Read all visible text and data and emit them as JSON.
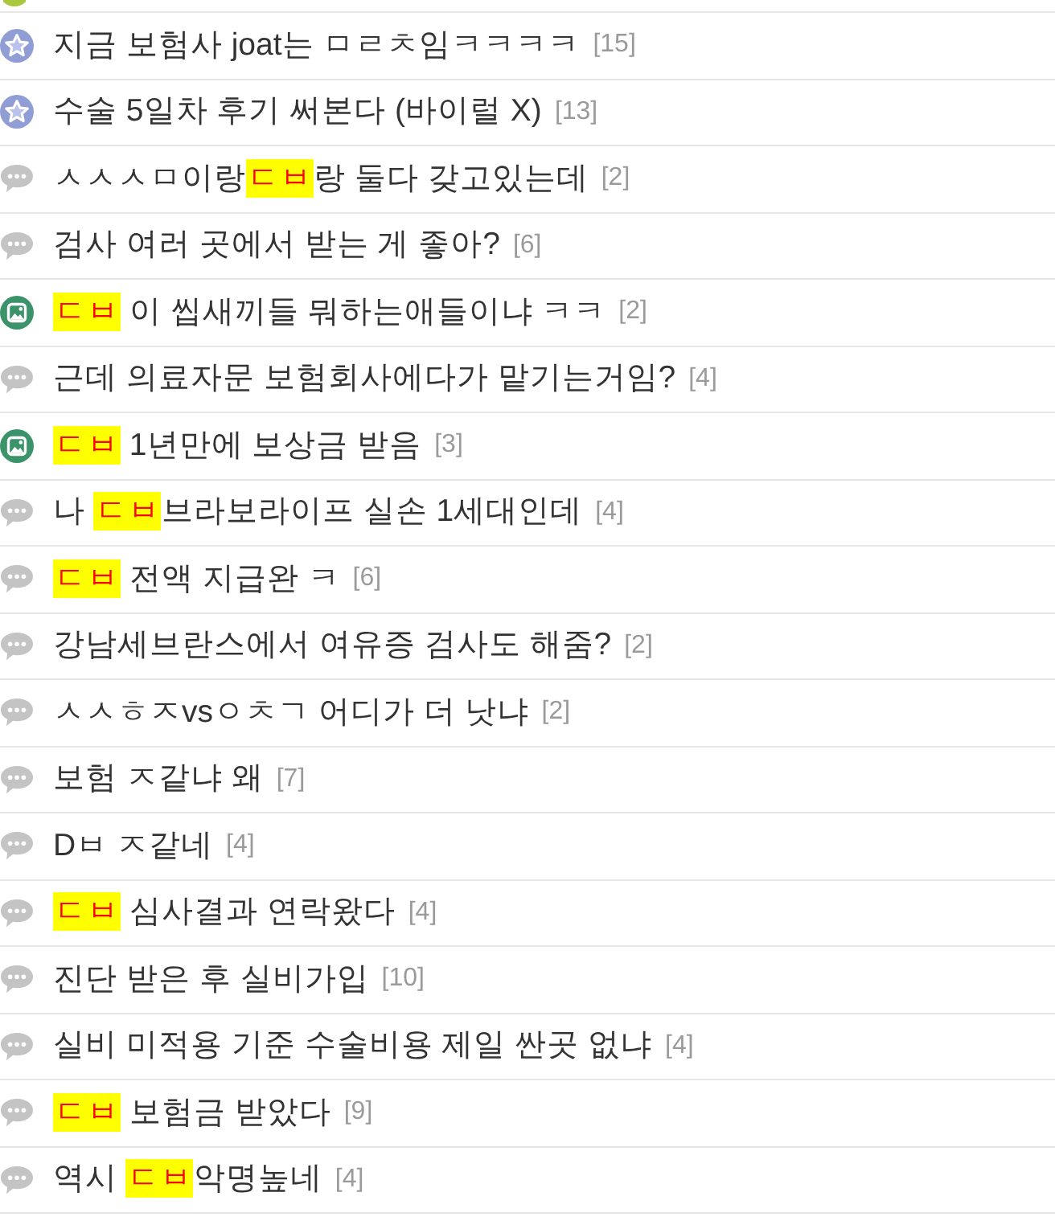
{
  "clipped_post_above": {
    "kind": "badge"
  },
  "posts": [
    {
      "kind": "star",
      "title": [
        {
          "text": "지금 보험사 joat는 ㅁㄹㅊ임ㅋㅋㅋㅋ",
          "highlight": false
        }
      ],
      "comments": "[15]"
    },
    {
      "kind": "star",
      "title": [
        {
          "text": "수술 5일차 후기 써본다 (바이럴 X)",
          "highlight": false
        }
      ],
      "comments": "[13]"
    },
    {
      "kind": "bubble",
      "title": [
        {
          "text": "ㅅㅅㅅㅁ이랑",
          "highlight": false
        },
        {
          "text": "ㄷㅂ",
          "highlight": true
        },
        {
          "text": "랑 둘다 갖고있는데",
          "highlight": false
        }
      ],
      "comments": "[2]"
    },
    {
      "kind": "bubble",
      "title": [
        {
          "text": "검사 여러 곳에서 받는 게 좋아?",
          "highlight": false
        }
      ],
      "comments": "[6]"
    },
    {
      "kind": "photo",
      "title": [
        {
          "text": "ㄷㅂ",
          "highlight": true
        },
        {
          "text": " 이 씹새끼들 뭐하는애들이냐 ㅋㅋ",
          "highlight": false
        }
      ],
      "comments": "[2]"
    },
    {
      "kind": "bubble",
      "title": [
        {
          "text": "근데 의료자문 보험회사에다가 맡기는거임?",
          "highlight": false
        }
      ],
      "comments": "[4]"
    },
    {
      "kind": "photo",
      "title": [
        {
          "text": "ㄷㅂ",
          "highlight": true
        },
        {
          "text": " 1년만에 보상금 받음",
          "highlight": false
        }
      ],
      "comments": "[3]"
    },
    {
      "kind": "bubble",
      "title": [
        {
          "text": "나 ",
          "highlight": false
        },
        {
          "text": "ㄷㅂ",
          "highlight": true
        },
        {
          "text": "브라보라이프 실손 1세대인데",
          "highlight": false
        }
      ],
      "comments": "[4]"
    },
    {
      "kind": "bubble",
      "title": [
        {
          "text": "ㄷㅂ",
          "highlight": true
        },
        {
          "text": " 전액 지급완 ㅋ",
          "highlight": false
        }
      ],
      "comments": "[6]"
    },
    {
      "kind": "bubble",
      "title": [
        {
          "text": "강남세브란스에서 여유증 검사도 해줌?",
          "highlight": false
        }
      ],
      "comments": "[2]"
    },
    {
      "kind": "bubble",
      "title": [
        {
          "text": "ㅅㅅㅎㅈvsㅇㅊㄱ 어디가 더 낫냐",
          "highlight": false
        }
      ],
      "comments": "[2]"
    },
    {
      "kind": "bubble",
      "title": [
        {
          "text": "보험 ㅈ같냐 왜",
          "highlight": false
        }
      ],
      "comments": "[7]"
    },
    {
      "kind": "bubble",
      "title": [
        {
          "text": "Dㅂ ㅈ같네",
          "highlight": false
        }
      ],
      "comments": "[4]"
    },
    {
      "kind": "bubble",
      "title": [
        {
          "text": "ㄷㅂ",
          "highlight": true
        },
        {
          "text": " 심사결과 연락왔다",
          "highlight": false
        }
      ],
      "comments": "[4]"
    },
    {
      "kind": "bubble",
      "title": [
        {
          "text": "진단 받은 후 실비가입",
          "highlight": false
        }
      ],
      "comments": "[10]"
    },
    {
      "kind": "bubble",
      "title": [
        {
          "text": "실비 미적용 기준 수술비용 제일 싼곳 없냐",
          "highlight": false
        }
      ],
      "comments": "[4]"
    },
    {
      "kind": "bubble",
      "title": [
        {
          "text": "ㄷㅂ",
          "highlight": true
        },
        {
          "text": " 보험금 받았다",
          "highlight": false
        }
      ],
      "comments": "[9]"
    },
    {
      "kind": "bubble",
      "title": [
        {
          "text": "역시 ",
          "highlight": false
        },
        {
          "text": "ㄷㅂ",
          "highlight": true
        },
        {
          "text": "악명높네",
          "highlight": false
        }
      ],
      "comments": "[4]"
    }
  ]
}
